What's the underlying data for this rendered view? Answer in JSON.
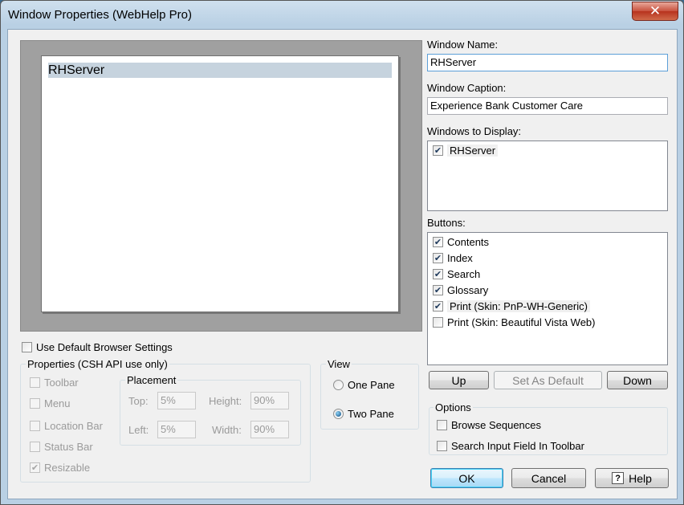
{
  "window": {
    "title": "Window Properties (WebHelp Pro)",
    "close_label": "✕"
  },
  "preview": {
    "item": "RHServer"
  },
  "fields": {
    "window_name_label": "Window Name:",
    "window_name_value": "RHServer",
    "window_caption_label": "Window Caption:",
    "window_caption_value": "Experience Bank Customer Care",
    "windows_to_display_label": "Windows to Display:",
    "windows_to_display": [
      {
        "label": "RHServer",
        "checked": true
      }
    ],
    "buttons_label": "Buttons:",
    "buttons": [
      {
        "label": "Contents",
        "checked": true
      },
      {
        "label": "Index",
        "checked": true
      },
      {
        "label": "Search",
        "checked": true
      },
      {
        "label": "Glossary",
        "checked": true
      },
      {
        "label": "Print (Skin: PnP-WH-Generic)",
        "checked": true
      },
      {
        "label": "Print (Skin: Beautiful Vista Web)",
        "checked": false
      }
    ]
  },
  "list_buttons": {
    "up": "Up",
    "set_default": "Set As Default",
    "down": "Down"
  },
  "options": {
    "title": "Options",
    "browse_sequences": "Browse Sequences",
    "search_input": "Search Input Field In Toolbar"
  },
  "use_default": "Use Default Browser Settings",
  "properties": {
    "title": "Properties (CSH API use only)",
    "toolbar": "Toolbar",
    "menu": "Menu",
    "location_bar": "Location Bar",
    "status_bar": "Status Bar",
    "resizable": "Resizable"
  },
  "placement": {
    "title": "Placement",
    "top_label": "Top:",
    "top_value": "5%",
    "left_label": "Left:",
    "left_value": "5%",
    "height_label": "Height:",
    "height_value": "90%",
    "width_label": "Width:",
    "width_value": "90%"
  },
  "view": {
    "title": "View",
    "one_pane": "One Pane",
    "two_pane": "Two Pane",
    "selected": "two_pane"
  },
  "dialog_buttons": {
    "ok": "OK",
    "cancel": "Cancel",
    "help": "Help"
  }
}
